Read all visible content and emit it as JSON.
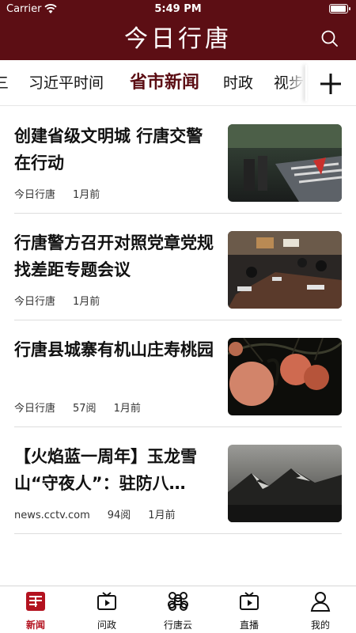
{
  "status": {
    "carrier": "Carrier",
    "time": "5:49 PM",
    "battery": 1.0
  },
  "header": {
    "title": "今日行唐"
  },
  "tabs": {
    "items": [
      {
        "label": "要闻",
        "visible": "三"
      },
      {
        "label": "习近平时间"
      },
      {
        "label": "省市新闻",
        "active": true
      },
      {
        "label": "时政"
      },
      {
        "label": "视频",
        "visible": "视步"
      }
    ]
  },
  "news": [
    {
      "title": "创建省级文明城 行唐交警在行动",
      "source": "今日行唐",
      "reads": "",
      "time": "1月前"
    },
    {
      "title": "行唐警方召开对照党章党规找差距专题会议",
      "source": "今日行唐",
      "reads": "",
      "time": "1月前"
    },
    {
      "title": "行唐县城寨有机山庄寿桃园",
      "source": "今日行唐",
      "reads": "57阅",
      "time": "1月前"
    },
    {
      "title": "【火焰蓝一周年】玉龙雪山“守夜人”：驻防八…",
      "source": "news.cctv.com",
      "reads": "94阅",
      "time": "1月前"
    }
  ],
  "bottom_nav": [
    {
      "label": "新闻",
      "icon": "news-icon",
      "active": true
    },
    {
      "label": "问政",
      "icon": "tv-icon"
    },
    {
      "label": "行唐云",
      "icon": "cloud-knot-icon"
    },
    {
      "label": "直播",
      "icon": "live-tv-icon"
    },
    {
      "label": "我的",
      "icon": "user-icon"
    }
  ],
  "colors": {
    "brand": "#5c0e14",
    "active_nav": "#b3121f"
  }
}
